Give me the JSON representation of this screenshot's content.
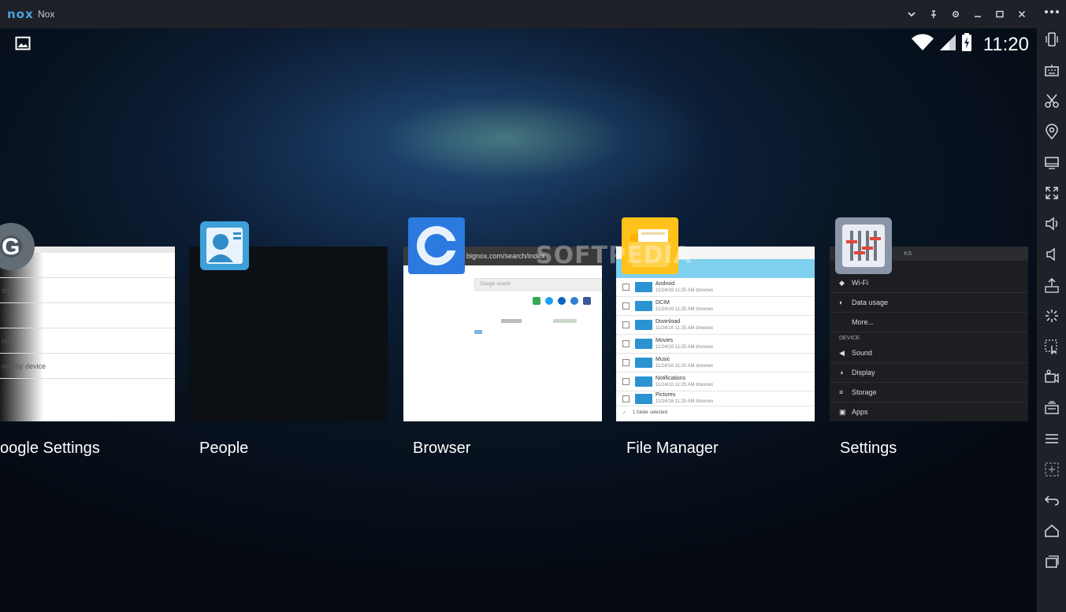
{
  "window": {
    "logo": "nox",
    "title": "Nox",
    "controls": [
      "chevron-down-icon",
      "pin-icon",
      "gear-icon",
      "minimize-icon",
      "maximize-icon",
      "close-icon"
    ]
  },
  "status_bar": {
    "time": "11:20"
  },
  "watermark": "SOFTPEDIA",
  "recents": [
    {
      "label": "oogle Settings",
      "rows": [
        "y",
        "tion",
        "",
        "rity",
        "nearby device"
      ]
    },
    {
      "label": "People"
    },
    {
      "label": "Browser",
      "url": "bignox.com/search/index",
      "search_placeholder": "Google search"
    },
    {
      "label": "File Manager",
      "rows": [
        {
          "name": "Android",
          "meta": "11/24/16 11:25 AM   drwxrwx"
        },
        {
          "name": "DCIM",
          "meta": "11/24/16 11:25 AM   drwxrwx"
        },
        {
          "name": "Download",
          "meta": "11/24/16 11:25 AM   drwxrwx"
        },
        {
          "name": "Movies",
          "meta": "11/24/16 11:25 AM   drwxrwx"
        },
        {
          "name": "Music",
          "meta": "11/24/16 11:25 AM   drwxrwx"
        },
        {
          "name": "Notifications",
          "meta": "11/24/16 11:25 AM   drwxrwx"
        },
        {
          "name": "Pictures",
          "meta": "11/24/16 11:25 AM   drwxrwx"
        }
      ],
      "footer": "1 folder selected"
    },
    {
      "label": "Settings",
      "header": "KS",
      "section_device": "DEVICE",
      "rows": [
        "Wi-Fi",
        "Data usage",
        "More...",
        "Sound",
        "Display",
        "Storage",
        "Apps"
      ]
    }
  ],
  "sidebar_tools": [
    "more-icon",
    "shake-icon",
    "keyboard-icon",
    "scissors-icon",
    "location-icon",
    "screen-icon",
    "fullscreen-icon",
    "volume-up-icon",
    "volume-down-icon",
    "apk-icon",
    "loading-icon",
    "macro-icon",
    "record-icon",
    "multi-instance-icon",
    "menu-icon",
    "add-icon",
    "back-icon",
    "home-icon",
    "recents-icon"
  ]
}
